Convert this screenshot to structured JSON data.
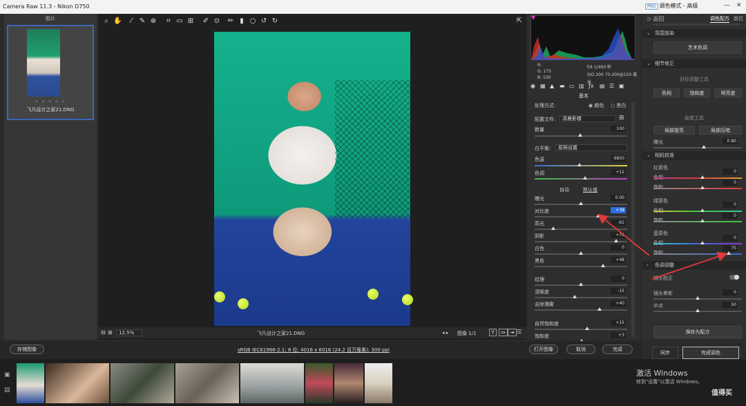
{
  "window": {
    "title": "Camera Raw 11.3 -  Nikon D750",
    "mode_badge": "PRO",
    "mode_label": "调色模式 - 高级"
  },
  "filmstrip_header": "胶片",
  "thumbnail": {
    "stars": "• • • • •",
    "filename": "飞凡设计之家21.DNG"
  },
  "histogram": {
    "rgb": [
      "R:",
      "G:   175",
      "B:   130"
    ],
    "exif": [
      "f/4  1/400 秒",
      "ISO 200  70-200@150 毫米"
    ]
  },
  "panel": {
    "section_title": "基本",
    "process_label": "处理方式:",
    "process_color": "颜色",
    "process_bw": "黑白",
    "profile_label": "配置文件:",
    "profile_value": "清晨影楼",
    "amount_label": "数量",
    "amount_value": "100",
    "wb_label": "白平衡:",
    "wb_value": "原照设置",
    "temp_label": "色温",
    "temp_value": "6850",
    "tint_label": "色调",
    "tint_value": "+12",
    "auto_label": "自动",
    "default_label": "默认值",
    "sliders": [
      {
        "label": "曝光",
        "value": "0.00",
        "pos": 0.5
      },
      {
        "label": "对比度",
        "value": "+38",
        "pos": 0.69,
        "hl": true
      },
      {
        "label": "高光",
        "value": "-61",
        "pos": 0.2
      },
      {
        "label": "阴影",
        "value": "+76",
        "pos": 0.88
      },
      {
        "label": "白色",
        "value": "0",
        "pos": 0.5
      },
      {
        "label": "黑色",
        "value": "+48",
        "pos": 0.74
      }
    ],
    "presence": [
      {
        "label": "纹理",
        "value": "0",
        "pos": 0.5
      },
      {
        "label": "清晰度",
        "value": "-15",
        "pos": 0.43
      },
      {
        "label": "去除薄雾",
        "value": "+40",
        "pos": 0.7
      }
    ],
    "vibrance": [
      {
        "label": "自然饱和度",
        "value": "+15",
        "pos": 0.57
      },
      {
        "label": "饱和度",
        "value": "+3",
        "pos": 0.51
      }
    ]
  },
  "zoom": "12.5%",
  "photo_filename": "飞凡设计之家21.DNG",
  "image_counter": "图像 1/1",
  "far": {
    "back": "返回",
    "tab_color": "调色配方",
    "tab_other": "前位",
    "sec1": "氛围渲染",
    "art_btn": "艺术色调",
    "sec2": "细节修正",
    "target_tools": "目标调整工具",
    "btn_hue": "色相",
    "btn_sat": "饱和度",
    "btn_lum": "明亮度",
    "brush_tools": "画笔工具",
    "btn_brighten": "局部提亮",
    "btn_darken": "局部压暗",
    "exposure_label": "曝光",
    "exposure_value": "0.80",
    "sec3": "相机校准",
    "red_primary": "红原色",
    "red_hue": "0",
    "red_sat": "0",
    "green_primary": "绿原色",
    "green_hue": "0",
    "green_sat": "0",
    "blue_primary": "蓝原色",
    "blue_hue": "0",
    "blue_sat": "75",
    "sec4": "色调调整",
    "lens_label": "镜头校正",
    "vignette_label": "镜头晕影",
    "vignette_value": "0",
    "mid_label": "中点",
    "mid_value": "50",
    "hue_label": "色相",
    "sat_label": "饱和",
    "save_preset": "保存为配方",
    "sync": "同步",
    "finish_color": "完成调色"
  },
  "actions": {
    "save": "存储图像",
    "info": "sRGB IEC61966-2.1; 8 位; 4016 x 6016 (24.2 百万像素); 300 ppi",
    "open": "打开图像",
    "cancel": "取消",
    "done": "完成"
  },
  "watermark": {
    "line1": "激活 Windows",
    "line2": "转到\"设置\"以激活 Windows。"
  },
  "logo": "值得买",
  "colors": {
    "accent": "#2a6de0",
    "arrow": "#e0393a",
    "thumb_border": "#3d66b8"
  },
  "icons": [
    "zoom-icon",
    "hand-icon",
    "white-balance-icon",
    "color-sampler-icon",
    "targeted-adjust-icon",
    "crop-icon",
    "straighten-icon",
    "transform-icon",
    "spot-removal-icon",
    "red-eye-icon",
    "adjustment-brush-icon",
    "graduated-filter-icon",
    "radial-filter-icon",
    "rotate-left-icon",
    "rotate-right-icon"
  ]
}
